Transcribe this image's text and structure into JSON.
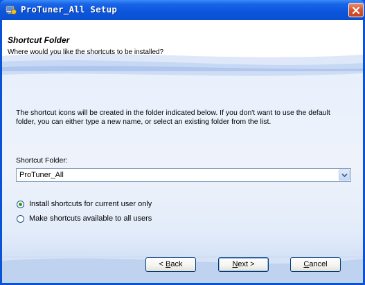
{
  "window": {
    "title": "ProTuner_All Setup",
    "close_icon": "close-icon"
  },
  "header": {
    "title": "Shortcut Folder",
    "subtitle": "Where would you like the shortcuts to be installed?"
  },
  "body": {
    "description": "The shortcut icons will be created in the folder indicated below. If you don't want to use the default folder, you can either type a new name, or select an existing folder from the list.",
    "folder_label": "Shortcut Folder:",
    "folder_value": "ProTuner_All",
    "radio_options": [
      {
        "label": "Install shortcuts for current user only",
        "selected": true
      },
      {
        "label": "Make shortcuts available to all users",
        "selected": false
      }
    ]
  },
  "buttons": {
    "back": {
      "prefix": "< ",
      "accel": "B",
      "rest": "ack"
    },
    "next": {
      "prefix": "",
      "accel": "N",
      "rest": "ext >"
    },
    "cancel": {
      "prefix": "",
      "accel": "C",
      "rest": "ancel"
    }
  },
  "colors": {
    "titlebar": "#0a52d6",
    "close": "#d9542b",
    "radio_dot": "#21a121"
  }
}
